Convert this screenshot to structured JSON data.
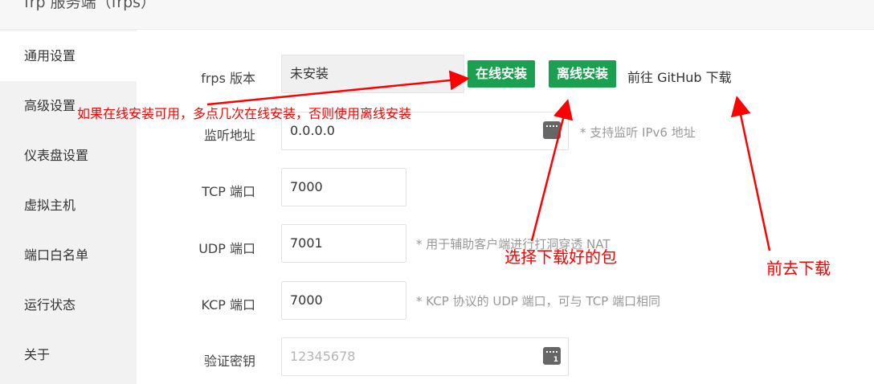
{
  "window": {
    "title": "frp 服务端（frps）"
  },
  "sidebar": {
    "items": [
      {
        "label": "通用设置"
      },
      {
        "label": "高级设置"
      },
      {
        "label": "仪表盘设置"
      },
      {
        "label": "虚拟主机"
      },
      {
        "label": "端口白名单"
      },
      {
        "label": "运行状态"
      },
      {
        "label": "关于"
      }
    ]
  },
  "form": {
    "version": {
      "label": "frps 版本",
      "value": "未安装",
      "online_button": "在线安装",
      "offline_button": "离线安装",
      "github_text": "前往 GitHub 下载"
    },
    "bind_addr": {
      "label": "监听地址",
      "value": "0.0.0.0",
      "hint": "* 支持监听 IPv6 地址"
    },
    "tcp_port": {
      "label": "TCP 端口",
      "value": "7000"
    },
    "udp_port": {
      "label": "UDP 端口",
      "value": "7001",
      "hint": "* 用于辅助客户端进行打洞穿透 NAT"
    },
    "kcp_port": {
      "label": "KCP 端口",
      "value": "7000",
      "hint": "* KCP 协议的 UDP 端口，可与 TCP 端口相同"
    },
    "token": {
      "label": "验证密钥",
      "placeholder": "12345678"
    }
  },
  "annotations": {
    "online_tip": "如果在线安装可用，多点几次在线安装，否则使用离线安装",
    "offline_tip": "选择下载好的包",
    "github_tip": "前去下载",
    "color": "#ff0000"
  }
}
